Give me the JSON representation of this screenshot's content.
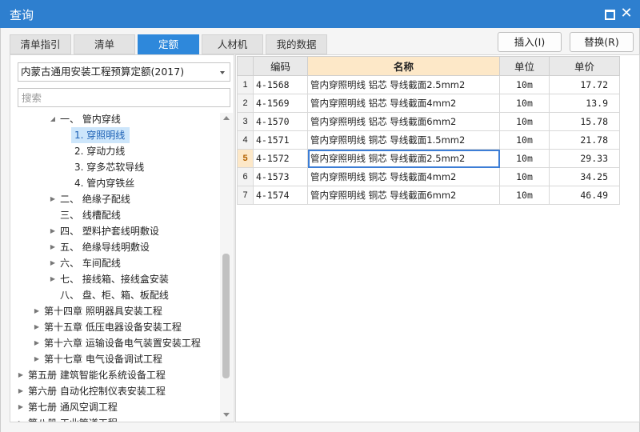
{
  "window": {
    "title": "查询"
  },
  "tabs": [
    {
      "label": "清单指引",
      "active": false
    },
    {
      "label": "清单",
      "active": false
    },
    {
      "label": "定额",
      "active": true
    },
    {
      "label": "人材机",
      "active": false
    },
    {
      "label": "我的数据",
      "active": false
    }
  ],
  "buttons": {
    "insert": "插入(I)",
    "replace": "替换(R)"
  },
  "library_select": {
    "value": "内蒙古通用安装工程预算定额(2017)"
  },
  "search": {
    "placeholder": "搜索"
  },
  "tree": [
    {
      "label": "一、 管内穿线",
      "expander": "expanded"
    },
    {
      "label": "1. 穿照明线",
      "expander": "none",
      "selected": true
    },
    {
      "label": "2. 穿动力线",
      "expander": "none"
    },
    {
      "label": "3. 穿多芯软导线",
      "expander": "none"
    },
    {
      "label": "4. 管内穿铁丝",
      "expander": "none"
    },
    {
      "label": "二、 绝缘子配线",
      "expander": "collapsed"
    },
    {
      "label": "三、 线槽配线",
      "expander": "none"
    },
    {
      "label": "四、 塑料护套线明敷设",
      "expander": "collapsed"
    },
    {
      "label": "五、 绝缘导线明敷设",
      "expander": "collapsed"
    },
    {
      "label": "六、 车间配线",
      "expander": "collapsed"
    },
    {
      "label": "七、 接线箱、接线盒安装",
      "expander": "collapsed"
    },
    {
      "label": "八、 盘、柜、箱、板配线",
      "expander": "none"
    },
    {
      "label": "第十四章 照明器具安装工程",
      "expander": "collapsed"
    },
    {
      "label": "第十五章 低压电器设备安装工程",
      "expander": "collapsed"
    },
    {
      "label": "第十六章 运输设备电气装置安装工程",
      "expander": "collapsed"
    },
    {
      "label": "第十七章 电气设备调试工程",
      "expander": "collapsed"
    },
    {
      "label": "第五册 建筑智能化系统设备工程",
      "expander": "collapsed"
    },
    {
      "label": "第六册 自动化控制仪表安装工程",
      "expander": "collapsed"
    },
    {
      "label": "第七册 通风空调工程",
      "expander": "collapsed"
    },
    {
      "label": "第八册 工业管道工程",
      "expander": "collapsed"
    }
  ],
  "table": {
    "headers": {
      "code": "编码",
      "name": "名称",
      "unit": "单位",
      "price": "单价"
    },
    "rows": [
      {
        "idx": "1",
        "code": "4-1568",
        "name": "管内穿照明线 铝芯 导线截面2.5mm2",
        "unit": "10m",
        "price": "17.72"
      },
      {
        "idx": "2",
        "code": "4-1569",
        "name": "管内穿照明线 铝芯 导线截面4mm2",
        "unit": "10m",
        "price": "13.9"
      },
      {
        "idx": "3",
        "code": "4-1570",
        "name": "管内穿照明线 铝芯 导线截面6mm2",
        "unit": "10m",
        "price": "15.78"
      },
      {
        "idx": "4",
        "code": "4-1571",
        "name": "管内穿照明线 铜芯 导线截面1.5mm2",
        "unit": "10m",
        "price": "21.78"
      },
      {
        "idx": "5",
        "code": "4-1572",
        "name": "管内穿照明线 铜芯 导线截面2.5mm2",
        "unit": "10m",
        "price": "29.33",
        "current": true
      },
      {
        "idx": "6",
        "code": "4-1573",
        "name": "管内穿照明线 铜芯 导线截面4mm2",
        "unit": "10m",
        "price": "34.25"
      },
      {
        "idx": "7",
        "code": "4-1574",
        "name": "管内穿照明线 铜芯 导线截面6mm2",
        "unit": "10m",
        "price": "46.49"
      }
    ]
  }
}
